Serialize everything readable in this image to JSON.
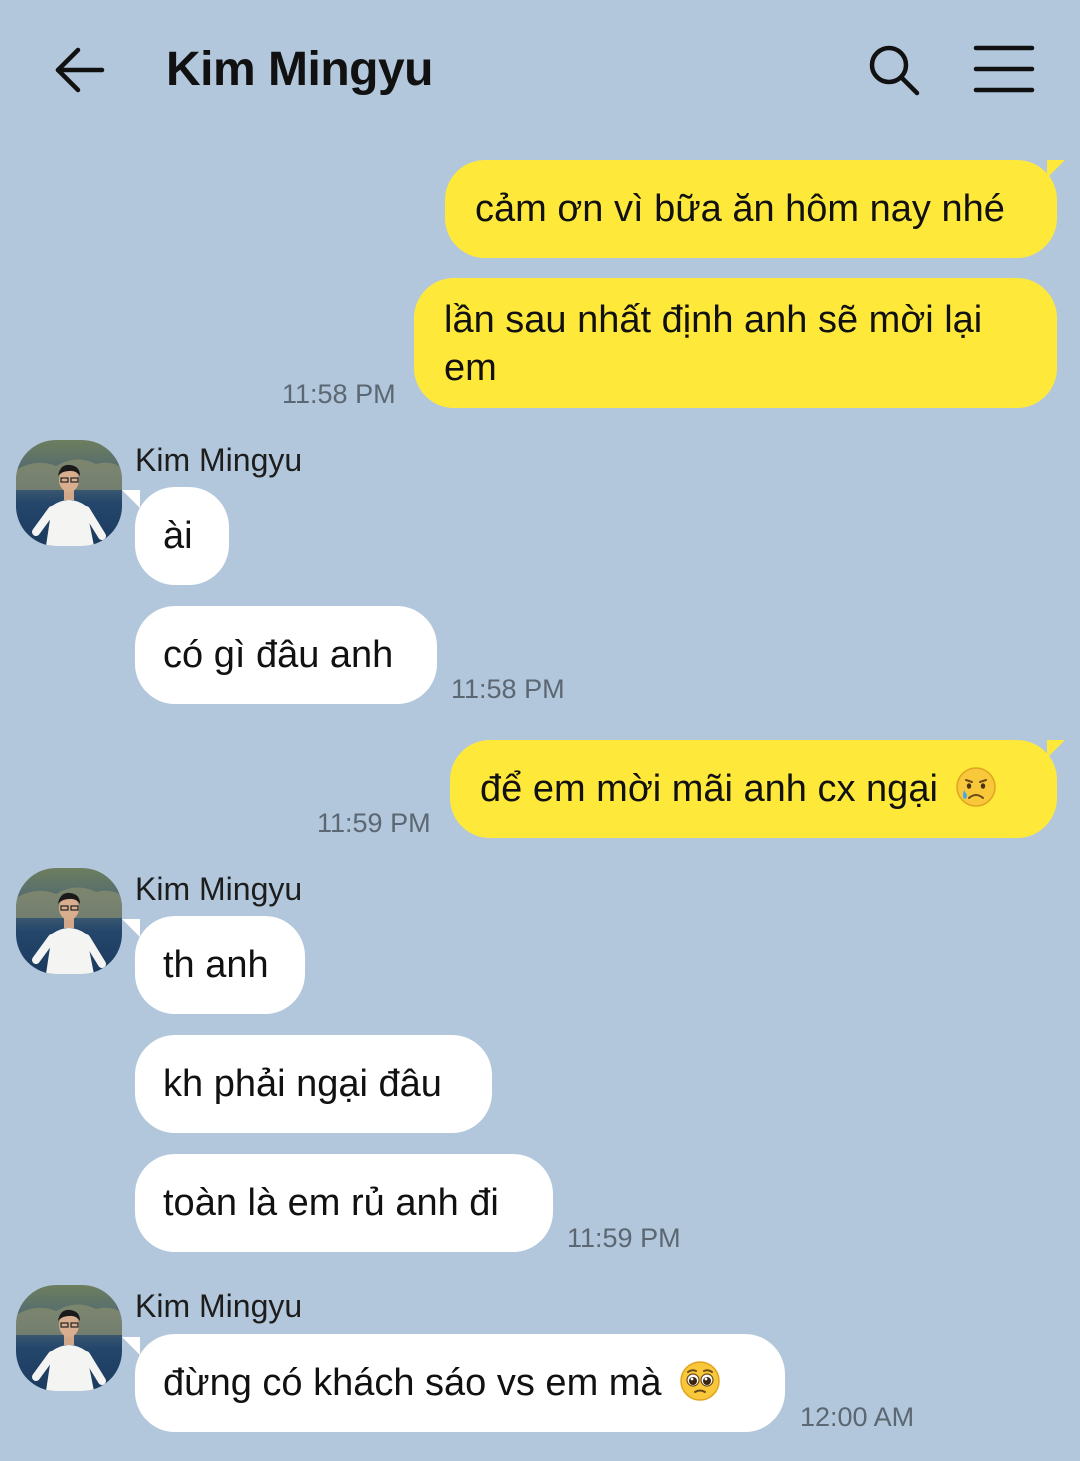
{
  "header": {
    "title": "Kim Mingyu",
    "back_icon": "arrow-left-icon",
    "search_icon": "search-icon",
    "menu_icon": "hamburger-menu-icon"
  },
  "colors": {
    "background": "#b2c7db",
    "my_bubble": "#fee93b",
    "their_bubble": "#ffffff"
  },
  "messages": [
    {
      "from": "me",
      "text": "cảm ơn vì bữa ăn hôm nay nhé"
    },
    {
      "from": "me",
      "line1": "lần sau nhất định anh sẽ mời lại",
      "line2": "em",
      "time": "11:58 PM"
    },
    {
      "from": "them",
      "sender": "Kim Mingyu",
      "text": "ài"
    },
    {
      "from": "them",
      "text": "có gì đâu anh",
      "time": "11:58 PM"
    },
    {
      "from": "me",
      "text": "để em mời mãi anh cx ngại",
      "emoji": "sad-tear-emoji",
      "time": "11:59 PM"
    },
    {
      "from": "them",
      "sender": "Kim Mingyu",
      "text": "th anh"
    },
    {
      "from": "them",
      "text": "kh phải ngại đâu"
    },
    {
      "from": "them",
      "text": "toàn là em rủ anh đi",
      "time": "11:59 PM"
    },
    {
      "from": "them",
      "sender": "Kim Mingyu",
      "text": "đừng có khách sáo vs em mà",
      "emoji": "pleading-face-emoji",
      "time": "12:00 AM"
    }
  ]
}
